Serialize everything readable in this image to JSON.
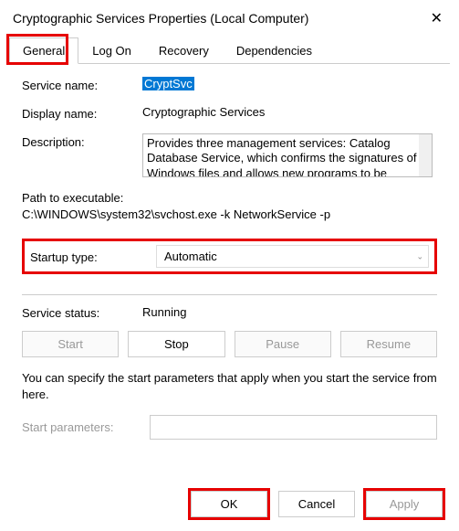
{
  "window": {
    "title": "Cryptographic Services Properties (Local Computer)"
  },
  "tabs": {
    "general": "General",
    "logon": "Log On",
    "recovery": "Recovery",
    "dependencies": "Dependencies"
  },
  "labels": {
    "service_name": "Service name:",
    "display_name": "Display name:",
    "description": "Description:",
    "path_label": "Path to executable:",
    "startup_type": "Startup type:",
    "service_status": "Service status:",
    "start_params": "Start parameters:"
  },
  "values": {
    "service_name": "CryptSvc",
    "display_name": "Cryptographic Services",
    "description": "Provides three management services: Catalog Database Service, which confirms the signatures of Windows files and allows new programs to be",
    "path": "C:\\WINDOWS\\system32\\svchost.exe -k NetworkService -p",
    "startup_type": "Automatic",
    "status": "Running",
    "start_params": ""
  },
  "buttons": {
    "start": "Start",
    "stop": "Stop",
    "pause": "Pause",
    "resume": "Resume",
    "ok": "OK",
    "cancel": "Cancel",
    "apply": "Apply"
  },
  "hint": "You can specify the start parameters that apply when you start the service from here."
}
